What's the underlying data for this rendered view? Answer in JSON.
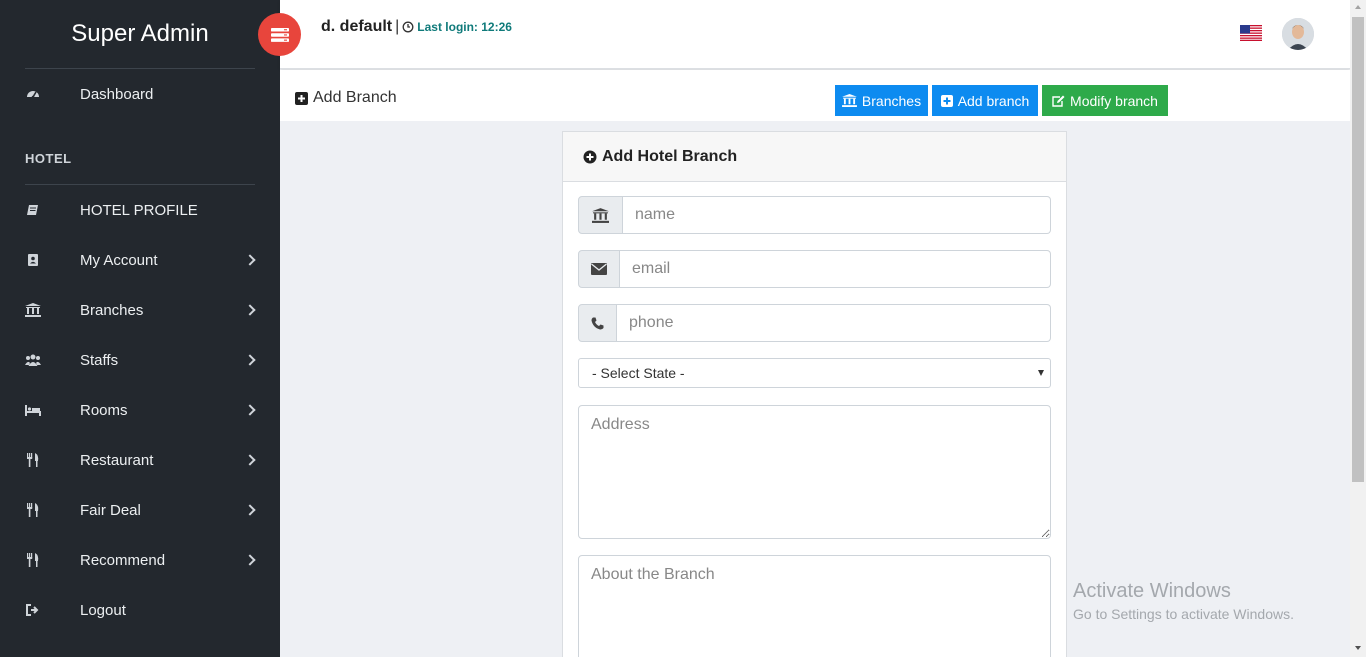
{
  "sidebar": {
    "brand": "Super Admin",
    "section_label": "HOTEL",
    "items": [
      {
        "label": "Dashboard",
        "icon": "dashboard-icon"
      },
      {
        "label": "HOTEL PROFILE",
        "icon": "book-icon"
      },
      {
        "label": "My Account",
        "icon": "address-book-icon"
      },
      {
        "label": "Branches",
        "icon": "bank-icon"
      },
      {
        "label": "Staffs",
        "icon": "users-icon"
      },
      {
        "label": "Rooms",
        "icon": "bed-icon"
      },
      {
        "label": "Restaurant",
        "icon": "cutlery-icon"
      },
      {
        "label": "Fair Deal",
        "icon": "cutlery-icon"
      },
      {
        "label": "Recommend",
        "icon": "cutlery-icon"
      },
      {
        "label": "Logout",
        "icon": "sign-out-icon"
      }
    ]
  },
  "topbar": {
    "user_name": "d. default",
    "separator": "|",
    "last_login": "Last login: 12:26"
  },
  "header": {
    "title": "Add Branch",
    "buttons": {
      "branches": "Branches",
      "add_branch": "Add branch",
      "modify_branch": "Modify branch"
    }
  },
  "form": {
    "title": "Add Hotel Branch",
    "name_placeholder": "name",
    "email_placeholder": "email",
    "phone_placeholder": "phone",
    "state_selected": "- Select State -",
    "address_placeholder": "Address",
    "about_placeholder": "About the Branch"
  },
  "watermark": {
    "title": "Activate Windows",
    "subtitle": "Go to Settings to activate Windows."
  },
  "colors": {
    "sidebar_bg": "#23282e",
    "toggle_red": "#e8453c",
    "primary_blue": "#0d8bf0",
    "success_green": "#2eaa4a",
    "login_teal": "#0f7a7a"
  }
}
